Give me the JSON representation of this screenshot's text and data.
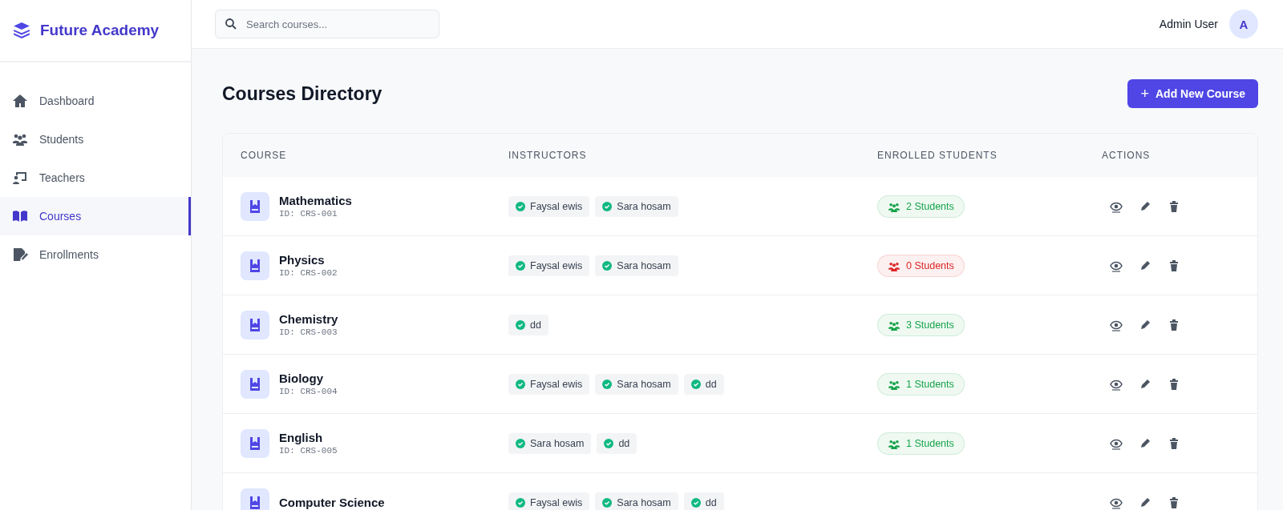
{
  "brand": {
    "name": "Future Academy"
  },
  "sidebar": {
    "items": [
      {
        "label": "Dashboard",
        "selected": false
      },
      {
        "label": "Students",
        "selected": false
      },
      {
        "label": "Teachers",
        "selected": false
      },
      {
        "label": "Courses",
        "selected": true
      },
      {
        "label": "Enrollments",
        "selected": false
      }
    ]
  },
  "search": {
    "placeholder": "Search courses..."
  },
  "user": {
    "name": "Admin User",
    "avatar": "A"
  },
  "page": {
    "title": "Courses Directory",
    "add_button": "Add New Course",
    "add_icon": "+"
  },
  "table": {
    "columns": [
      "COURSE",
      "INSTRUCTORS",
      "ENROLLED STUDENTS",
      "ACTIONS"
    ],
    "rows": [
      {
        "name": "Mathematics",
        "id": "ID: CRS-001",
        "instructors": [
          "Faysal ewis",
          "Sara hosam"
        ],
        "students": "2 Students",
        "color": "#16a34a"
      },
      {
        "name": "Physics",
        "id": "ID: CRS-002",
        "instructors": [
          "Faysal ewis",
          "Sara hosam"
        ],
        "students": "0 Students",
        "color": "#dc2626"
      },
      {
        "name": "Chemistry",
        "id": "ID: CRS-003",
        "instructors": [
          "dd"
        ],
        "students": "3 Students",
        "color": "#16a34a"
      },
      {
        "name": "Biology",
        "id": "ID: CRS-004",
        "instructors": [
          "Faysal ewis",
          "Sara hosam",
          "dd"
        ],
        "students": "1 Students",
        "color": "#16a34a"
      },
      {
        "name": "English",
        "id": "ID: CRS-005",
        "instructors": [
          "Sara hosam",
          "dd"
        ],
        "students": "1 Students",
        "color": "#16a34a"
      },
      {
        "name": "Computer Science",
        "instructors": [
          "Faysal ewis",
          "Sara hosam",
          "dd"
        ]
      }
    ]
  }
}
